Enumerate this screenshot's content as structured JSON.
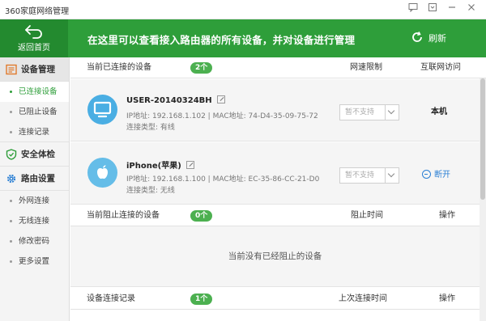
{
  "window": {
    "title": "360家庭网络管理"
  },
  "header": {
    "back_label": "返回首页",
    "headline": "在这里可以查看接入路由器的所有设备，并对设备进行管理",
    "refresh_label": "刷新"
  },
  "sidebar": {
    "sections": [
      {
        "label": "设备管理",
        "icon": "device-manage-icon",
        "items": [
          "已连接设备",
          "已阻止设备",
          "连接记录"
        ]
      },
      {
        "label": "安全体检",
        "icon": "shield-icon",
        "items": []
      },
      {
        "label": "路由设置",
        "icon": "gear-icon",
        "items": [
          "外网连接",
          "无线连接",
          "修改密码",
          "更多设置"
        ]
      }
    ]
  },
  "connected": {
    "title": "当前已连接的设备",
    "count": "2个",
    "col_speed": "网速限制",
    "col_access": "互联网访问",
    "devices": [
      {
        "name": "USER-20140324BH",
        "info": "IP地址: 192.168.1.102 | MAC地址: 74-D4-35-09-75-72",
        "type": "连接类型: 有线",
        "speed": "暂不支持",
        "access": "本机",
        "icon": "monitor-icon"
      },
      {
        "name": "iPhone(苹果)",
        "info": "IP地址: 192.168.1.100 | MAC地址: EC-35-86-CC-21-D0",
        "type": "连接类型: 无线",
        "speed": "暂不支持",
        "access": "断开",
        "icon": "apple-icon"
      }
    ]
  },
  "blocked": {
    "title": "当前阻止连接的设备",
    "count": "0个",
    "col_time": "阻止时间",
    "col_action": "操作",
    "empty": "当前没有已经阻止的设备"
  },
  "records": {
    "title": "设备连接记录",
    "count": "1个",
    "col_time": "上次连接时间",
    "col_action": "操作"
  },
  "colors": {
    "brand_green": "#2e9e3a",
    "badge_green": "#4cb050",
    "link_blue": "#2a7fd4",
    "device_blue": "#4aaee3"
  }
}
